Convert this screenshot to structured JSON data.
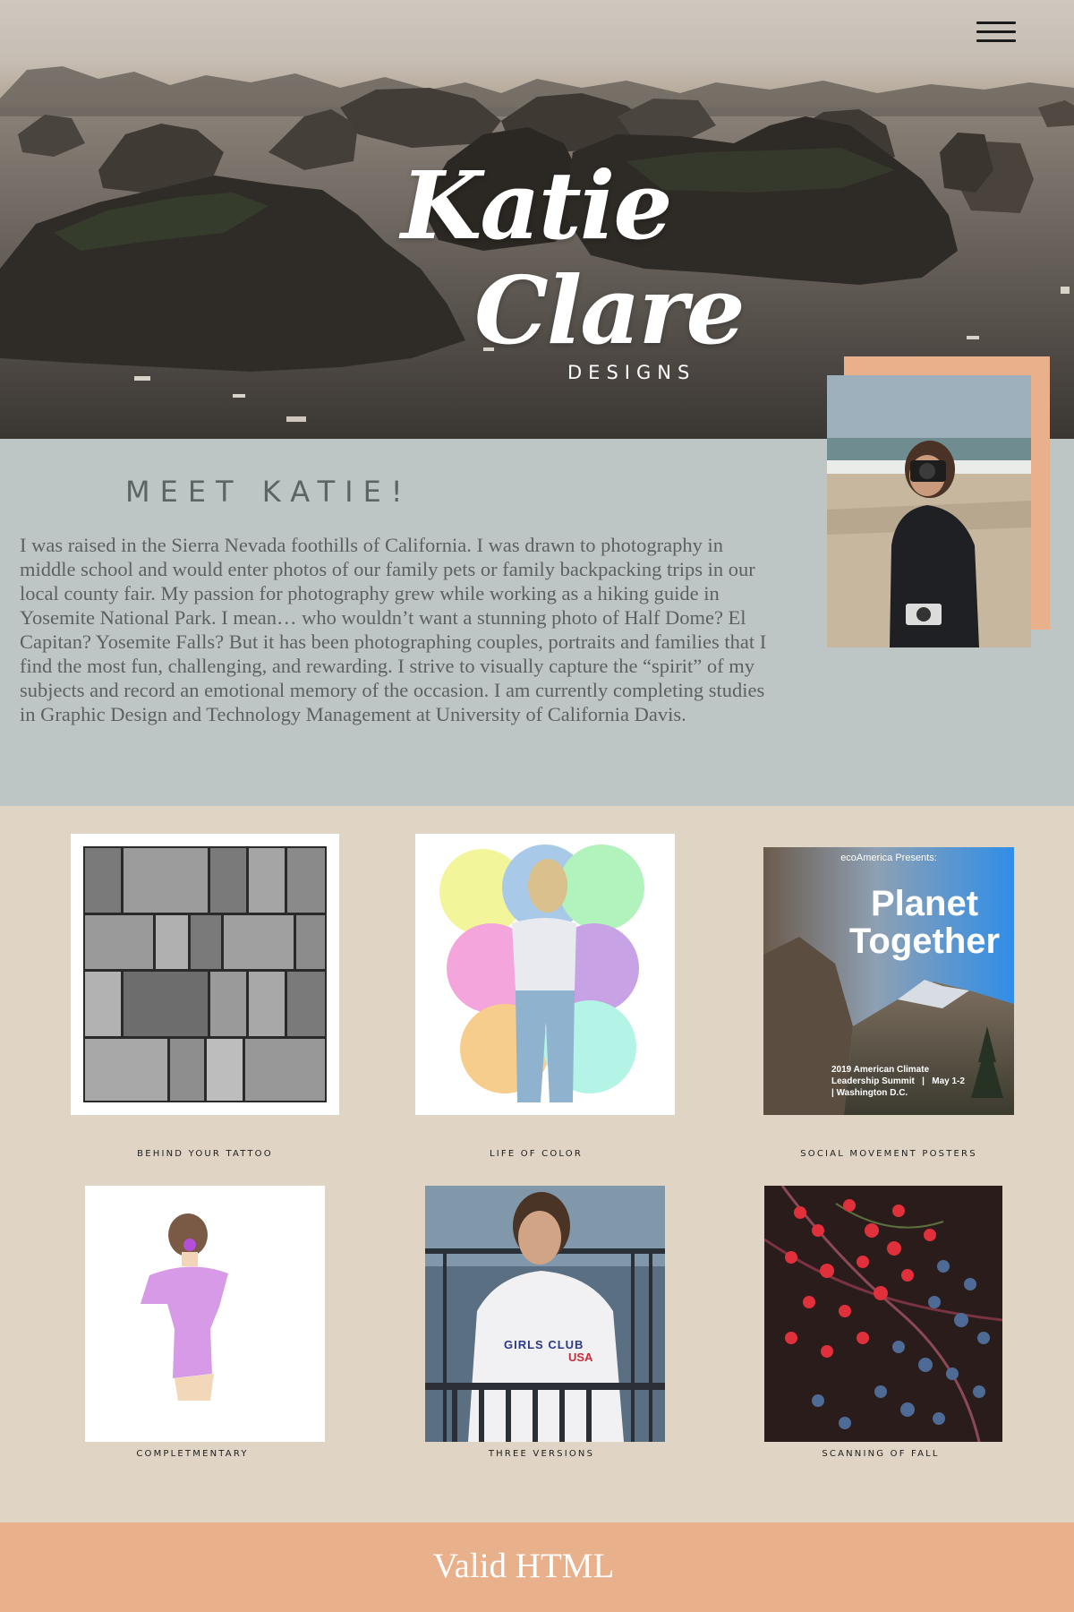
{
  "hero": {
    "logo_line1": "Katie",
    "logo_line2": "Clare",
    "logo_sub": "DESIGNS",
    "menu_icon": "hamburger-menu-icon"
  },
  "about": {
    "heading": "MEET KATIE!",
    "body": "I was raised in the Sierra Nevada foothills of California. I was drawn to photography in middle school and would enter photos of our family pets or family backpacking trips in our local county fair. My passion for photography grew while working as a hiking guide in Yosemite National Park. I mean… who wouldn’t want a stunning photo of Half Dome? El Capitan? Yosemite Falls? But it has been photographing couples, portraits and families that I find the most fun, challenging, and rewarding. I strive to visually capture the “spirit” of my subjects and record an emotional memory of the occasion. I am currently completing studies in Graphic Design and Technology Management at University of California Davis.",
    "photo_frame_color": "#e8b08b"
  },
  "gallery": {
    "items": [
      {
        "caption": "BEHIND YOUR TATTOO"
      },
      {
        "caption": "LIFE OF COLOR"
      },
      {
        "caption": "SOCIAL MOVEMENT POSTERS",
        "poster_top": "ecoAmerica Presents:",
        "poster_title_1": "Planet",
        "poster_title_2": "Together",
        "poster_bottom_1": "2019 American Climate",
        "poster_bottom_2": "Leadership Summit   |   May 1-2",
        "poster_bottom_3": "| Washington D.C."
      },
      {
        "caption": "COMPLETMENTARY"
      },
      {
        "caption": "THREE VERSIONS",
        "shirt_text_1": "GIRLS CLUB",
        "shirt_text_2": "USA"
      },
      {
        "caption": "SCANNING OF FALL"
      }
    ]
  },
  "footer": {
    "link": "Valid HTML"
  },
  "colors": {
    "about_bg": "#bec6c5",
    "gallery_bg": "#e0d4c4",
    "footer_bg": "#e8b08b",
    "accent": "#e8b08b"
  }
}
